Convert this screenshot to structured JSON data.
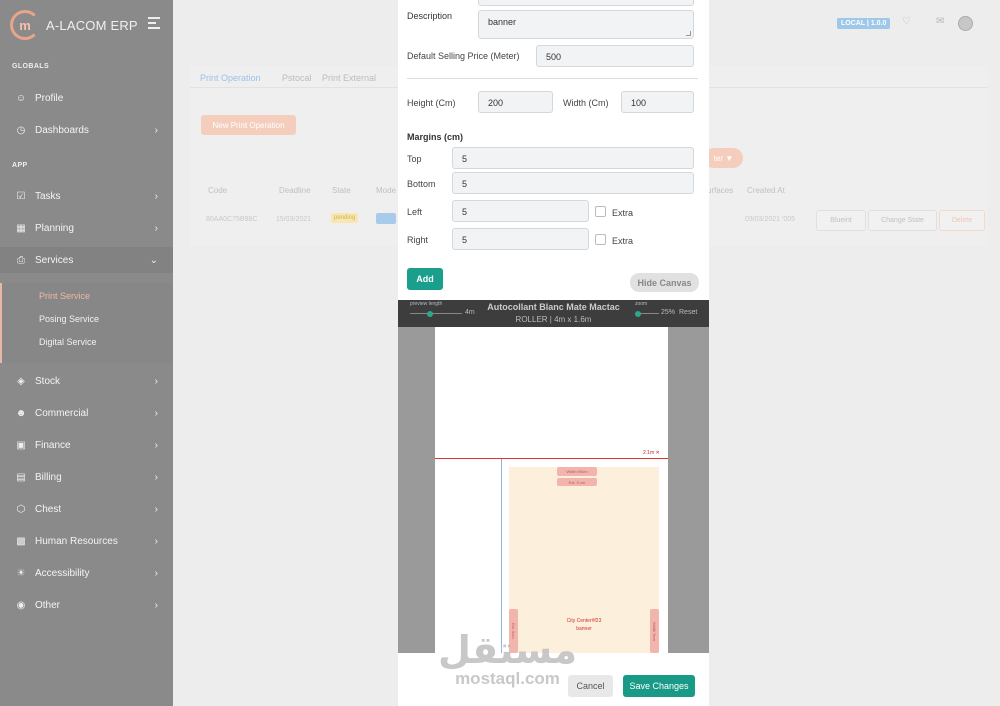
{
  "app": {
    "brand": "A-LACOM ERP",
    "logo_letter": "m",
    "version_badge": "LOCAL | 1.0.0"
  },
  "sidebar": {
    "globals_label": "GLOBALS",
    "app_label": "APP",
    "items": [
      {
        "label": "Profile"
      },
      {
        "label": "Dashboards"
      },
      {
        "label": "Tasks"
      },
      {
        "label": "Planning"
      },
      {
        "label": "Services"
      },
      {
        "label": "Stock"
      },
      {
        "label": "Commercial"
      },
      {
        "label": "Finance"
      },
      {
        "label": "Billing"
      },
      {
        "label": "Chest"
      },
      {
        "label": "Human Resources"
      },
      {
        "label": "Accessibility"
      },
      {
        "label": "Other"
      }
    ],
    "services_sub": [
      "Print Service",
      "Posing Service",
      "Digital Service"
    ]
  },
  "background": {
    "tabs": [
      "Print Operation",
      "Pstocal",
      "Print External"
    ],
    "new_button": "New Print Operation",
    "filter_button": "ter",
    "columns": [
      "Code",
      "Deadline",
      "State",
      "Mode",
      "urfaces",
      "Created At"
    ],
    "row": {
      "code": "80AA0C75B98C",
      "deadline": "15/03/2021",
      "state": "pending",
      "created": "03/03/2021 '005"
    },
    "actions": [
      "Blueint",
      "Change State",
      "Delete"
    ]
  },
  "modal": {
    "description_label": "Description",
    "description_value": "banner",
    "price_label": "Default Selling Price (Meter)",
    "price_value": "500",
    "height_label": "Height (Cm)",
    "height_value": "200",
    "width_label": "Width (Cm)",
    "width_value": "100",
    "margins_label": "Margins (cm)",
    "top_label": "Top",
    "top_value": "5",
    "bottom_label": "Bottom",
    "bottom_value": "5",
    "left_label": "Left",
    "left_value": "5",
    "right_label": "Right",
    "right_value": "5",
    "extra_label": "Extra",
    "add_button": "Add",
    "hide_canvas_button": "Hide Canvas",
    "cancel_button": "Cancel",
    "save_button": "Save Changes"
  },
  "canvas": {
    "title": "Autocollant Blanc Mate Mactac",
    "subtitle": "ROLLER | 4m x 1.6m",
    "preview_length_label": "preview length",
    "preview_length_value": "4m",
    "zoom_label": "zoom",
    "zoom_value": "25%",
    "reset_label": "Reset",
    "remaining_label": "2.1m",
    "pill_top_1": "Width 90cm",
    "pill_top_2": "Ext. 5 cm",
    "pill_side_left": "Ext. 5cm",
    "pill_side_right": "Width 5cm",
    "print_line_1": "City Center#f23",
    "print_line_2": "banner"
  },
  "watermark": {
    "arabic": "مستقل",
    "latin": "mostaql.com"
  },
  "colors": {
    "primary": "#189a86",
    "accent": "#f5cdbd",
    "sidebar": "#8a8a8a"
  }
}
